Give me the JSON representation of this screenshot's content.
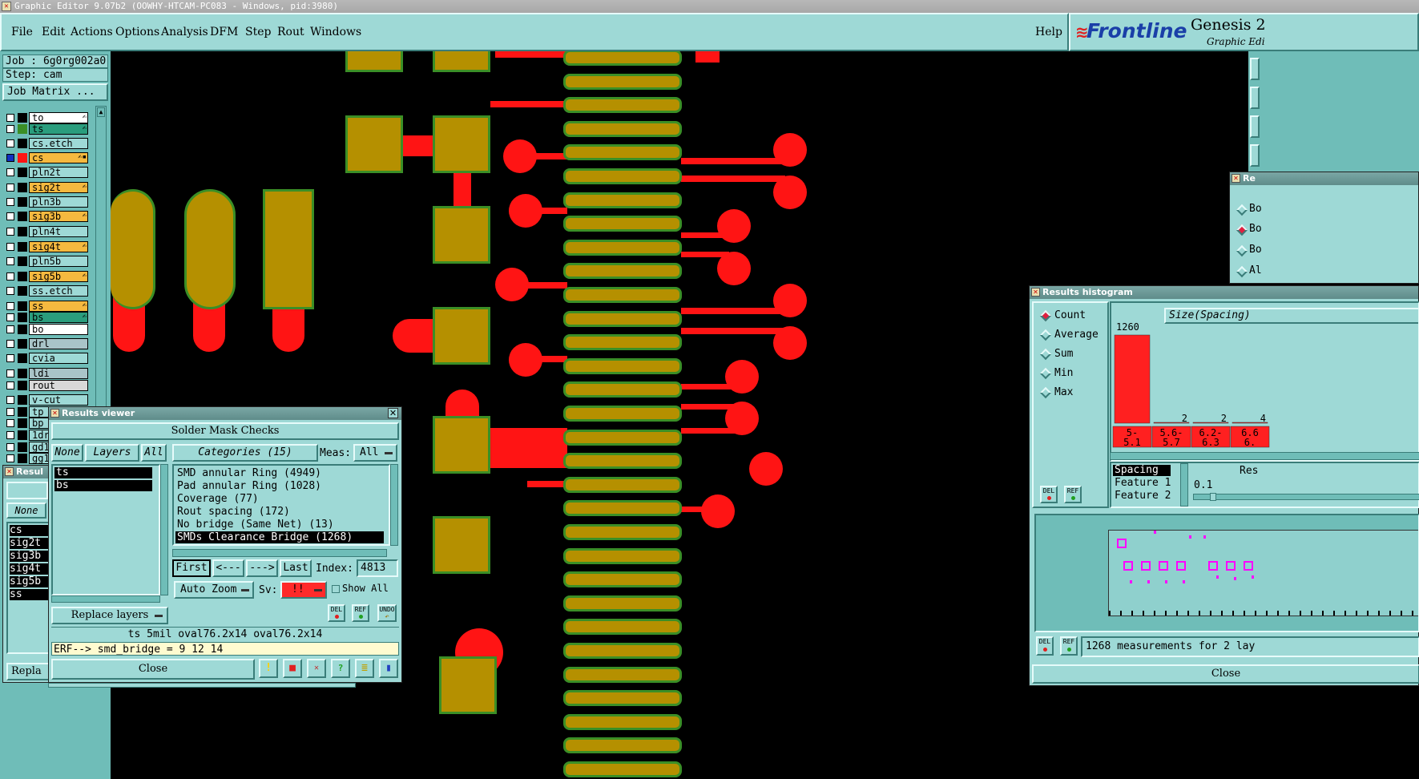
{
  "window": {
    "title": "Graphic Editor 9.07b2 (OOWHY-HTCAM-PC083 - Windows, pid:3980)"
  },
  "menu": [
    "File",
    "Edit",
    "Actions",
    "Options",
    "Analysis",
    "DFM",
    "Step",
    "Rout",
    "Windows"
  ],
  "help": "Help",
  "brand": {
    "logo": "Frontline",
    "product": "Genesis 2",
    "subtitle": "Graphic Edi"
  },
  "job": {
    "job_label": "Job : 6g0rg002a0",
    "step_label": "Step: cam",
    "matrix_btn": "Job Matrix ..."
  },
  "layers": [
    {
      "name": "to",
      "color": "#ffffff",
      "swatch": "#000000",
      "mark": "✍"
    },
    {
      "name": "ts",
      "color": "#2a9d7d",
      "swatch": "#3b8f26",
      "mark": "✍"
    },
    {
      "name": "cs.etch",
      "color": "#9ed9d6",
      "swatch": "#000000",
      "mark": ""
    },
    {
      "name": "cs",
      "color": "#f5b93f",
      "swatch": "#ff1414",
      "mark": "✍▪"
    },
    {
      "name": "pln2t",
      "color": "#9ed9d6",
      "swatch": "#000000",
      "mark": ""
    },
    {
      "name": "sig2t",
      "color": "#f5b93f",
      "swatch": "#000000",
      "mark": "✍"
    },
    {
      "name": "pln3b",
      "color": "#9ed9d6",
      "swatch": "#000000",
      "mark": ""
    },
    {
      "name": "sig3b",
      "color": "#f5b93f",
      "swatch": "#000000",
      "mark": "✍"
    },
    {
      "name": "pln4t",
      "color": "#9ed9d6",
      "swatch": "#000000",
      "mark": ""
    },
    {
      "name": "sig4t",
      "color": "#f5b93f",
      "swatch": "#000000",
      "mark": "✍"
    },
    {
      "name": "pln5b",
      "color": "#9ed9d6",
      "swatch": "#000000",
      "mark": ""
    },
    {
      "name": "sig5b",
      "color": "#f5b93f",
      "swatch": "#000000",
      "mark": "✍"
    },
    {
      "name": "ss.etch",
      "color": "#9ed9d6",
      "swatch": "#000000",
      "mark": ""
    },
    {
      "name": "ss",
      "color": "#f5b93f",
      "swatch": "#000000",
      "mark": "✍"
    },
    {
      "name": "bs",
      "color": "#2a9d7d",
      "swatch": "#000000",
      "mark": "✍"
    },
    {
      "name": "bo",
      "color": "#ffffff",
      "swatch": "#000000",
      "mark": ""
    },
    {
      "name": "drl",
      "color": "#a9c4c8",
      "swatch": "#000000",
      "mark": ""
    },
    {
      "name": "cvia",
      "color": "#9ed9d6",
      "swatch": "#000000",
      "mark": ""
    },
    {
      "name": "ldi",
      "color": "#a9c4c8",
      "swatch": "#000000",
      "mark": ""
    },
    {
      "name": "rout",
      "color": "#d8d8d8",
      "swatch": "#000000",
      "mark": ""
    },
    {
      "name": "v-cut",
      "color": "#9ed9d6",
      "swatch": "#000000",
      "mark": ""
    },
    {
      "name": "tp",
      "color": "#9ed9d6",
      "swatch": "#000000",
      "mark": ""
    },
    {
      "name": "bp",
      "color": "#9ed9d6",
      "swatch": "#000000",
      "mark": ""
    },
    {
      "name": "1dr",
      "color": "#9ed9d6",
      "swatch": "#000000",
      "mark": ""
    },
    {
      "name": "gd1",
      "color": "#9ed9d6",
      "swatch": "#000000",
      "mark": ""
    },
    {
      "name": "gg1",
      "color": "#9ed9d6",
      "swatch": "#000000",
      "mark": ""
    }
  ],
  "small_results": {
    "title": "Resul",
    "none": "None",
    "layers": [
      "cs",
      "sig2t",
      "sig3b",
      "sig4t",
      "sig5b",
      "ss"
    ],
    "replace": "Repla"
  },
  "results_viewer": {
    "title": "Results viewer",
    "header": "Solder Mask Checks",
    "none": "None",
    "layers_btn": "Layers",
    "all": "All",
    "categories_btn": "Categories (15)",
    "meas_label": "Meas:",
    "meas_value": "All",
    "layer_list": [
      "ts",
      "bs"
    ],
    "categories": [
      "SMD annular Ring (4949)",
      "Pad annular Ring (1028)",
      "Coverage (77)",
      "Rout spacing (172)",
      "No bridge (Same Net) (13)",
      "SMDs Clearance Bridge (1268)"
    ],
    "first": "First",
    "prev": "<---",
    "next": "--->",
    "last": "Last",
    "index_label": "Index:",
    "index_value": "4813",
    "auto_zoom": "Auto Zoom",
    "sv_label": "Sv:",
    "sv_value": "!!",
    "show_all": "Show All",
    "replace": "Replace layers",
    "del": "DEL",
    "ref": "REF",
    "undo": "UNDO",
    "info": "ts 5mil  oval76.2x14  oval76.2x14",
    "erf": "ERF--> smd_bridge = 9 12 14",
    "close": "Close"
  },
  "histogram": {
    "title": "Results histogram",
    "options": [
      {
        "label": "Count",
        "on": true
      },
      {
        "label": "Average",
        "on": false
      },
      {
        "label": "Sum",
        "on": false
      },
      {
        "label": "Min",
        "on": false
      },
      {
        "label": "Max",
        "on": false
      }
    ],
    "size_label": "Size(Spacing) ",
    "res_label": "Res",
    "fields": [
      "Spacing",
      "Feature 1",
      "Feature 2"
    ],
    "threshold": "0.1",
    "del": "DEL",
    "ref": "REF",
    "status": "1268 measurements for 2 lay",
    "close": "Close",
    "chart_data": {
      "type": "bar",
      "categories": [
        "5-\n5.1",
        "5.6-\n5.7",
        "6.2-\n6.3",
        "6.6\n6."
      ],
      "cat_top": [
        "5-",
        "5.6-",
        "6.2-",
        "6.6"
      ],
      "cat_bottom": [
        "5.1",
        "5.7",
        "6.3",
        "6."
      ],
      "values": [
        1260,
        2,
        2,
        4
      ],
      "value_labels": [
        "1260",
        "2",
        "2",
        "4"
      ]
    }
  },
  "right_small": {
    "title": "Re",
    "items": [
      "Bo",
      "Bo",
      "Bo",
      "Al"
    ]
  }
}
